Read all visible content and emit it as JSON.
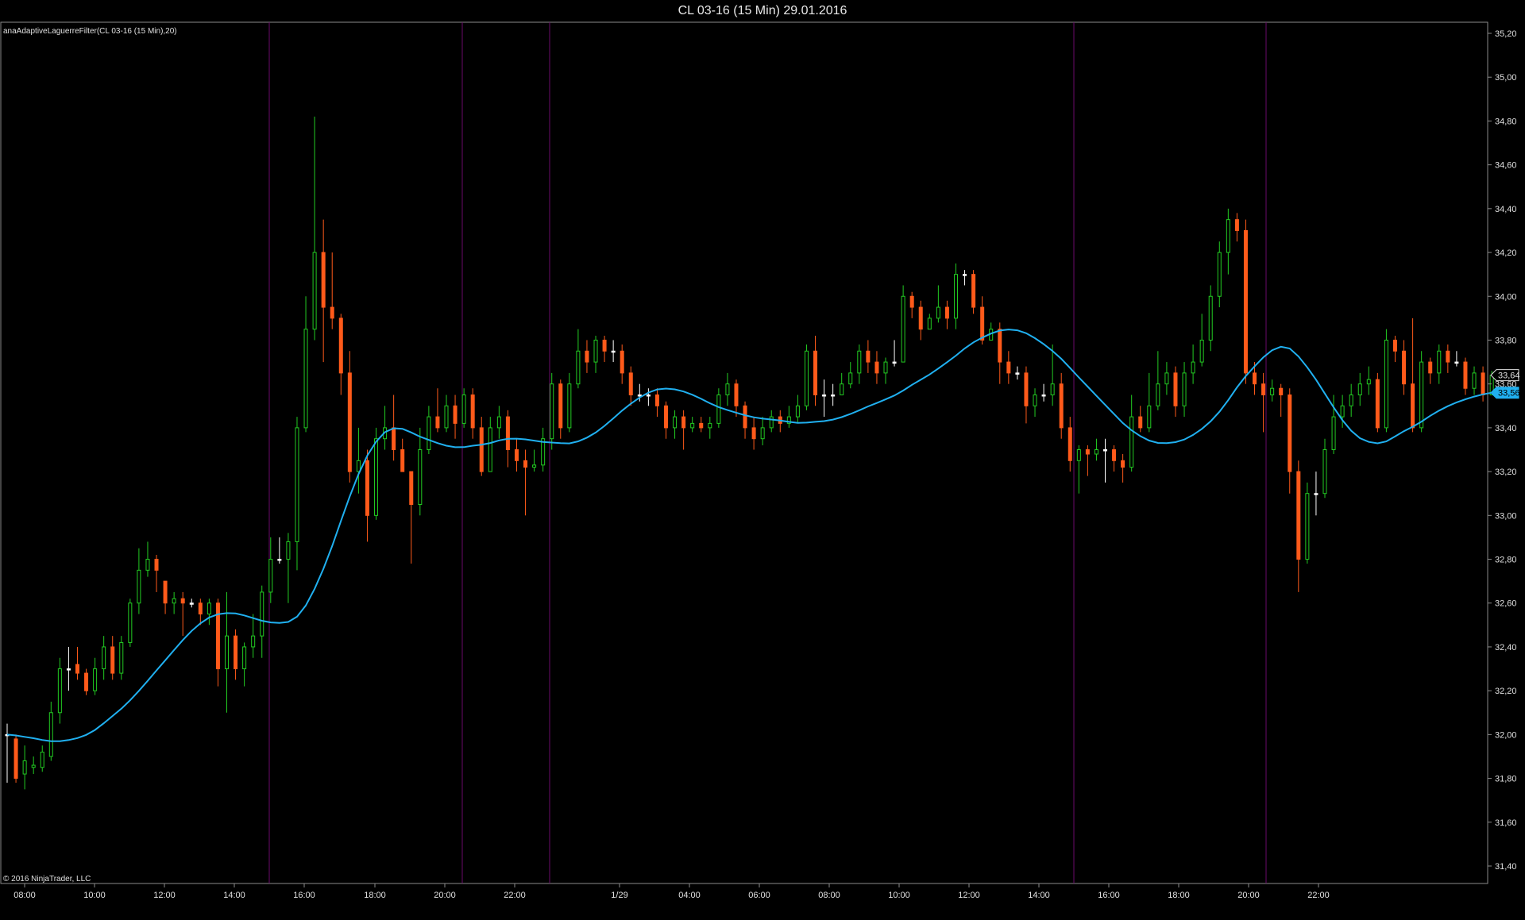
{
  "window": {
    "title": "CL 03-16 (15 Min)  29.01.2016"
  },
  "indicator_label": "anaAdaptiveLaguerreFilter(CL 03-16 (15 Min),20)",
  "copyright": "© 2016 NinjaTrader, LLC",
  "colors": {
    "background": "#000000",
    "up_candle": "#22cc22",
    "down_candle": "#ff5a1a",
    "doji": "#ffffff",
    "filter_line": "#20b0f0",
    "session_line": "#6a0a6a",
    "axis": "#8a8a8a"
  },
  "chart_data": {
    "type": "candlestick",
    "title": "CL 03-16 (15 Min)  29.01.2016",
    "y_ticks": [
      "35,20",
      "35,00",
      "34,80",
      "34,60",
      "34,40",
      "34,20",
      "34,00",
      "33,80",
      "33,60",
      "33,40",
      "33,20",
      "33,00",
      "32,80",
      "32,60",
      "32,40",
      "32,20",
      "32,00",
      "31,80",
      "31,60",
      "31,40"
    ],
    "x_ticks": [
      "08:00",
      "10:00",
      "12:00",
      "14:00",
      "16:00",
      "18:00",
      "20:00",
      "22:00",
      "1/29",
      "04:00",
      "06:00",
      "08:00",
      "10:00",
      "12:00",
      "14:00",
      "16:00",
      "18:00",
      "20:00",
      "22:00"
    ],
    "ylim": [
      31.35,
      35.25
    ],
    "last_price": "33,64",
    "filter_value": "33,56",
    "filter_last": 33.56,
    "candles": [
      [
        32.0,
        32.0,
        32.05,
        31.78
      ],
      [
        31.98,
        31.8,
        32.0,
        31.78
      ],
      [
        31.82,
        31.88,
        31.95,
        31.75
      ],
      [
        31.85,
        31.86,
        31.9,
        31.82
      ],
      [
        31.85,
        31.92,
        31.95,
        31.83
      ],
      [
        31.9,
        32.1,
        32.15,
        31.88
      ],
      [
        32.1,
        32.3,
        32.35,
        32.05
      ],
      [
        32.3,
        32.3,
        32.4,
        32.2
      ],
      [
        32.32,
        32.28,
        32.4,
        32.25
      ],
      [
        32.28,
        32.2,
        32.3,
        32.18
      ],
      [
        32.2,
        32.3,
        32.35,
        32.18
      ],
      [
        32.3,
        32.4,
        32.45,
        32.25
      ],
      [
        32.4,
        32.28,
        32.45,
        32.25
      ],
      [
        32.28,
        32.42,
        32.45,
        32.25
      ],
      [
        32.42,
        32.6,
        32.62,
        32.4
      ],
      [
        32.6,
        32.75,
        32.85,
        32.55
      ],
      [
        32.75,
        32.8,
        32.88,
        32.72
      ],
      [
        32.8,
        32.75,
        32.82,
        32.65
      ],
      [
        32.7,
        32.6,
        32.7,
        32.55
      ],
      [
        32.6,
        32.62,
        32.65,
        32.55
      ],
      [
        32.62,
        32.6,
        32.65,
        32.45
      ],
      [
        32.6,
        32.6,
        32.62,
        32.58
      ],
      [
        32.6,
        32.55,
        32.62,
        32.5
      ],
      [
        32.55,
        32.6,
        32.62,
        32.5
      ],
      [
        32.6,
        32.3,
        32.62,
        32.22
      ],
      [
        32.3,
        32.45,
        32.65,
        32.1
      ],
      [
        32.45,
        32.3,
        32.48,
        32.25
      ],
      [
        32.3,
        32.4,
        32.42,
        32.22
      ],
      [
        32.4,
        32.45,
        32.55,
        32.35
      ],
      [
        32.45,
        32.65,
        32.68,
        32.35
      ],
      [
        32.65,
        32.8,
        32.9,
        32.6
      ],
      [
        32.8,
        32.8,
        32.9,
        32.78
      ],
      [
        32.8,
        32.88,
        32.92,
        32.6
      ],
      [
        32.88,
        33.4,
        33.45,
        32.75
      ],
      [
        33.4,
        33.85,
        34.0,
        33.38
      ],
      [
        33.85,
        34.2,
        34.82,
        33.8
      ],
      [
        34.2,
        33.95,
        34.35,
        33.7
      ],
      [
        33.95,
        33.9,
        34.2,
        33.85
      ],
      [
        33.9,
        33.65,
        33.92,
        33.55
      ],
      [
        33.65,
        33.2,
        33.75,
        33.15
      ],
      [
        33.2,
        33.25,
        33.4,
        33.1
      ],
      [
        33.25,
        33.0,
        33.3,
        32.88
      ],
      [
        33.0,
        33.35,
        33.4,
        32.98
      ],
      [
        33.35,
        33.4,
        33.5,
        33.3
      ],
      [
        33.4,
        33.3,
        33.55,
        33.25
      ],
      [
        33.3,
        33.2,
        33.35,
        33.2
      ],
      [
        33.2,
        33.05,
        33.2,
        32.78
      ],
      [
        33.05,
        33.3,
        33.4,
        33.0
      ],
      [
        33.3,
        33.45,
        33.5,
        33.28
      ],
      [
        33.45,
        33.4,
        33.58,
        33.38
      ],
      [
        33.4,
        33.5,
        33.55,
        33.38
      ],
      [
        33.5,
        33.42,
        33.55,
        33.35
      ],
      [
        33.42,
        33.55,
        33.58,
        33.4
      ],
      [
        33.55,
        33.4,
        33.58,
        33.35
      ],
      [
        33.4,
        33.2,
        33.45,
        33.18
      ],
      [
        33.2,
        33.4,
        33.45,
        33.2
      ],
      [
        33.4,
        33.45,
        33.5,
        33.35
      ],
      [
        33.45,
        33.3,
        33.48,
        33.22
      ],
      [
        33.3,
        33.25,
        33.35,
        33.2
      ],
      [
        33.25,
        33.22,
        33.3,
        33.0
      ],
      [
        33.22,
        33.23,
        33.3,
        33.2
      ],
      [
        33.23,
        33.35,
        33.4,
        33.2
      ],
      [
        33.35,
        33.6,
        33.65,
        33.3
      ],
      [
        33.6,
        33.4,
        33.62,
        33.35
      ],
      [
        33.4,
        33.6,
        33.65,
        33.38
      ],
      [
        33.6,
        33.75,
        33.85,
        33.58
      ],
      [
        33.75,
        33.7,
        33.8,
        33.65
      ],
      [
        33.7,
        33.8,
        33.82,
        33.65
      ],
      [
        33.8,
        33.75,
        33.82,
        33.7
      ],
      [
        33.75,
        33.75,
        33.8,
        33.7
      ],
      [
        33.75,
        33.65,
        33.78,
        33.6
      ],
      [
        33.65,
        33.55,
        33.68,
        33.5
      ],
      [
        33.55,
        33.55,
        33.6,
        33.52
      ],
      [
        33.55,
        33.55,
        33.58,
        33.5
      ],
      [
        33.55,
        33.5,
        33.58,
        33.45
      ],
      [
        33.5,
        33.4,
        33.52,
        33.35
      ],
      [
        33.4,
        33.45,
        33.48,
        33.35
      ],
      [
        33.45,
        33.4,
        33.48,
        33.3
      ],
      [
        33.4,
        33.42,
        33.45,
        33.38
      ],
      [
        33.42,
        33.4,
        33.45,
        33.38
      ],
      [
        33.4,
        33.42,
        33.45,
        33.35
      ],
      [
        33.42,
        33.55,
        33.58,
        33.4
      ],
      [
        33.55,
        33.6,
        33.65,
        33.5
      ],
      [
        33.6,
        33.5,
        33.62,
        33.45
      ],
      [
        33.5,
        33.4,
        33.52,
        33.35
      ],
      [
        33.4,
        33.35,
        33.45,
        33.3
      ],
      [
        33.35,
        33.4,
        33.45,
        33.32
      ],
      [
        33.4,
        33.45,
        33.48,
        33.38
      ],
      [
        33.45,
        33.42,
        33.48,
        33.38
      ],
      [
        33.42,
        33.45,
        33.5,
        33.4
      ],
      [
        33.45,
        33.5,
        33.55,
        33.42
      ],
      [
        33.5,
        33.75,
        33.78,
        33.48
      ],
      [
        33.75,
        33.55,
        33.82,
        33.5
      ],
      [
        33.55,
        33.55,
        33.62,
        33.45
      ],
      [
        33.55,
        33.55,
        33.6,
        33.5
      ],
      [
        33.55,
        33.6,
        33.65,
        33.55
      ],
      [
        33.6,
        33.65,
        33.7,
        33.58
      ],
      [
        33.65,
        33.75,
        33.78,
        33.6
      ],
      [
        33.75,
        33.7,
        33.8,
        33.65
      ],
      [
        33.7,
        33.65,
        33.75,
        33.6
      ],
      [
        33.65,
        33.7,
        33.72,
        33.6
      ],
      [
        33.7,
        33.7,
        33.8,
        33.68
      ],
      [
        33.7,
        34.0,
        34.05,
        33.7
      ],
      [
        34.0,
        33.95,
        34.02,
        33.9
      ],
      [
        33.95,
        33.85,
        33.98,
        33.8
      ],
      [
        33.85,
        33.9,
        33.92,
        33.85
      ],
      [
        33.9,
        33.95,
        34.05,
        33.88
      ],
      [
        33.95,
        33.9,
        33.98,
        33.85
      ],
      [
        33.9,
        34.1,
        34.15,
        33.85
      ],
      [
        34.1,
        34.1,
        34.12,
        34.05
      ],
      [
        34.1,
        33.95,
        34.12,
        33.92
      ],
      [
        33.95,
        33.8,
        34.0,
        33.78
      ],
      [
        33.8,
        33.85,
        33.88,
        33.8
      ],
      [
        33.85,
        33.7,
        33.88,
        33.6
      ],
      [
        33.7,
        33.65,
        33.75,
        33.6
      ],
      [
        33.65,
        33.65,
        33.68,
        33.62
      ],
      [
        33.65,
        33.5,
        33.68,
        33.42
      ],
      [
        33.5,
        33.55,
        33.58,
        33.45
      ],
      [
        33.55,
        33.55,
        33.6,
        33.52
      ],
      [
        33.55,
        33.6,
        33.78,
        33.5
      ],
      [
        33.6,
        33.4,
        33.65,
        33.35
      ],
      [
        33.4,
        33.25,
        33.45,
        33.2
      ],
      [
        33.25,
        33.3,
        33.32,
        33.1
      ],
      [
        33.3,
        33.28,
        33.32,
        33.18
      ],
      [
        33.28,
        33.3,
        33.35,
        33.25
      ],
      [
        33.3,
        33.3,
        33.35,
        33.15
      ],
      [
        33.3,
        33.25,
        33.32,
        33.2
      ],
      [
        33.25,
        33.22,
        33.28,
        33.15
      ],
      [
        33.22,
        33.45,
        33.55,
        33.2
      ],
      [
        33.45,
        33.4,
        33.5,
        33.38
      ],
      [
        33.4,
        33.5,
        33.65,
        33.38
      ],
      [
        33.5,
        33.6,
        33.75,
        33.48
      ],
      [
        33.6,
        33.65,
        33.7,
        33.55
      ],
      [
        33.65,
        33.5,
        33.68,
        33.45
      ],
      [
        33.5,
        33.65,
        33.7,
        33.45
      ],
      [
        33.65,
        33.7,
        33.78,
        33.6
      ],
      [
        33.7,
        33.8,
        33.92,
        33.68
      ],
      [
        33.8,
        34.0,
        34.05,
        33.75
      ],
      [
        34.0,
        34.2,
        34.25,
        33.95
      ],
      [
        34.2,
        34.35,
        34.4,
        34.1
      ],
      [
        34.35,
        34.3,
        34.38,
        34.25
      ],
      [
        34.3,
        33.65,
        34.35,
        33.6
      ],
      [
        33.65,
        33.6,
        33.7,
        33.55
      ],
      [
        33.6,
        33.55,
        33.65,
        33.38
      ],
      [
        33.55,
        33.58,
        33.62,
        33.52
      ],
      [
        33.58,
        33.55,
        33.6,
        33.45
      ],
      [
        33.55,
        33.2,
        33.58,
        33.1
      ],
      [
        33.2,
        32.8,
        33.25,
        32.65
      ],
      [
        32.8,
        33.1,
        33.15,
        32.78
      ],
      [
        33.1,
        33.1,
        33.2,
        33.0
      ],
      [
        33.1,
        33.3,
        33.35,
        33.08
      ],
      [
        33.3,
        33.45,
        33.55,
        33.28
      ],
      [
        33.45,
        33.5,
        33.55,
        33.4
      ],
      [
        33.5,
        33.55,
        33.6,
        33.45
      ],
      [
        33.55,
        33.6,
        33.65,
        33.5
      ],
      [
        33.6,
        33.62,
        33.68,
        33.55
      ],
      [
        33.62,
        33.4,
        33.65,
        33.38
      ],
      [
        33.4,
        33.8,
        33.85,
        33.38
      ],
      [
        33.8,
        33.75,
        33.82,
        33.7
      ],
      [
        33.75,
        33.6,
        33.8,
        33.55
      ],
      [
        33.6,
        33.4,
        33.9,
        33.38
      ],
      [
        33.4,
        33.7,
        33.75,
        33.38
      ],
      [
        33.7,
        33.65,
        33.72,
        33.6
      ],
      [
        33.65,
        33.75,
        33.78,
        33.6
      ],
      [
        33.75,
        33.7,
        33.78,
        33.65
      ],
      [
        33.7,
        33.7,
        33.75,
        33.68
      ],
      [
        33.7,
        33.58,
        33.72,
        33.55
      ],
      [
        33.58,
        33.65,
        33.68,
        33.55
      ],
      [
        33.65,
        33.55,
        33.68,
        33.52
      ],
      [
        33.55,
        33.64,
        33.66,
        33.55
      ]
    ]
  }
}
